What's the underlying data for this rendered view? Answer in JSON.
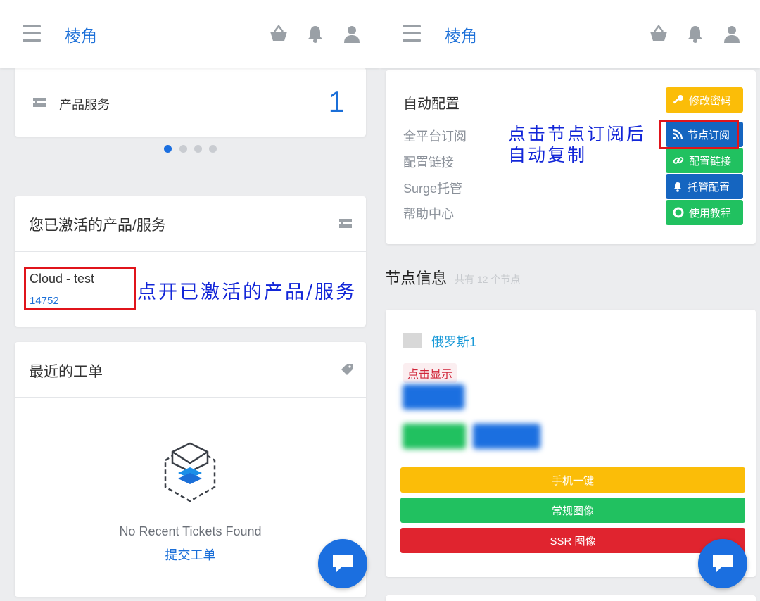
{
  "left": {
    "navbar": {
      "brand": "棱角"
    },
    "products_card": {
      "label": "产品服务",
      "count": "1"
    },
    "carousel": {
      "dots": 4,
      "active_index": 0
    },
    "active_services": {
      "title": "您已激活的产品/服务",
      "item_name": "Cloud - test",
      "item_id": "14752"
    },
    "annotation_open": "点开已激活的产品/服务",
    "tickets": {
      "title": "最近的工单",
      "empty_text": "No Recent Tickets Found",
      "submit_link": "提交工单"
    }
  },
  "right": {
    "navbar": {
      "brand": "棱角"
    },
    "auto_config": {
      "title": "自动配置",
      "rows": [
        "全平台订阅",
        "配置链接",
        "Surge托管",
        "帮助中心"
      ],
      "buttons": [
        "修改密码",
        "节点订阅",
        "配置链接",
        "托管配置",
        "使用教程"
      ]
    },
    "annotation_subscribe": [
      "点击节点订阅后",
      "自动复制"
    ],
    "nodes": {
      "title": "节点信息",
      "subtitle": "共有 12 个节点",
      "node_name": "俄罗斯1",
      "reveal_badge": "点击显示",
      "actions": [
        "手机一键",
        "常规图像",
        "SSR 图像"
      ]
    }
  },
  "colors": {
    "brand": "#1b6fd8",
    "warning": "#fbbd08",
    "primary": "#1565c0",
    "success": "#21c160",
    "danger": "#e0242f",
    "annotation": "#1226d8",
    "highlight_box": "#e0141b"
  }
}
